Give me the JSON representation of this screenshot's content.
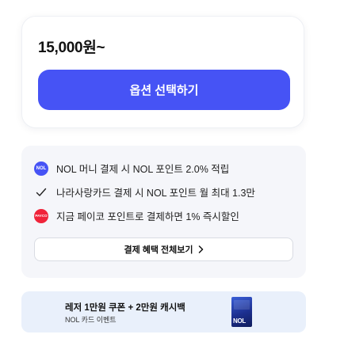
{
  "price_card": {
    "price": "15,000원~",
    "select_button": "옵션 선택하기"
  },
  "benefits": {
    "items": [
      {
        "icon": "nol-logo-icon",
        "badge_text": "NOL",
        "text": "NOL 머니 결제 시 NOL 포인트 2.0% 적립"
      },
      {
        "icon": "checkmark-icon",
        "text": "나라사랑카드 결제 시 NOL 포인트 월 최대 1.3만"
      },
      {
        "icon": "payco-logo-icon",
        "badge_text": "PAYCO",
        "text": "지금 페이코 포인트로 결제하면 1% 즉시할인"
      }
    ],
    "view_all_button": "결제 혜택 전체보기"
  },
  "promo": {
    "title": "레저 1만원 쿠폰 + 2만원 캐시백",
    "subtitle": "NOL 카드 이벤트",
    "card_label": "NOL"
  },
  "colors": {
    "primary": "#4653f5",
    "payco": "#f0243a",
    "benefits_bg": "#f5f6fa",
    "promo_bg": "#e9f0fb"
  }
}
